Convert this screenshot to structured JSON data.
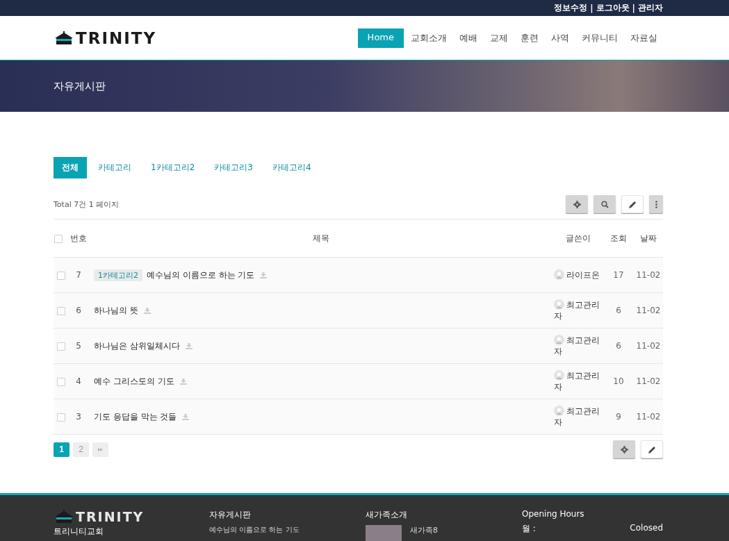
{
  "top_links": [
    "정보수정",
    "로그아웃",
    "관리자"
  ],
  "top_separator": "|",
  "logo": {
    "text": "TRINITY"
  },
  "nav": [
    {
      "label": "Home",
      "selected": true
    },
    {
      "label": "교회소개",
      "selected": false
    },
    {
      "label": "예배",
      "selected": false
    },
    {
      "label": "교제",
      "selected": false
    },
    {
      "label": "훈련",
      "selected": false
    },
    {
      "label": "사역",
      "selected": false
    },
    {
      "label": "커뮤니티",
      "selected": false
    },
    {
      "label": "자료실",
      "selected": false
    }
  ],
  "banner": {
    "title": "자유게시판"
  },
  "categories": [
    {
      "label": "전체",
      "selected": true
    },
    {
      "label": "카테고리",
      "selected": false
    },
    {
      "label": "1카테고리2",
      "selected": false
    },
    {
      "label": "카테고리3",
      "selected": false
    },
    {
      "label": "카테고리4",
      "selected": false
    }
  ],
  "summary": "Total 7건 1 페이지",
  "table": {
    "select_all_checked": false,
    "columns": [
      "번호",
      "제목",
      "글쓴이",
      "조회",
      "날짜"
    ],
    "rows": [
      {
        "checked": false,
        "number": "7",
        "category": "1카테고리2",
        "title": "예수님의 이름으로 하는 기도",
        "writer": "라이프온",
        "views": "17",
        "date": "11-02"
      },
      {
        "checked": false,
        "number": "6",
        "title": "하나님의 뜻",
        "writer": "최고관리자",
        "views": "6",
        "date": "11-02"
      },
      {
        "checked": false,
        "number": "5",
        "title": "하나님은 삼위일체시다",
        "writer": "최고관리자",
        "views": "6",
        "date": "11-02"
      },
      {
        "checked": false,
        "number": "4",
        "title": "예수 그리스도의 기도",
        "writer": "최고관리자",
        "views": "10",
        "date": "11-02"
      },
      {
        "checked": false,
        "number": "3",
        "title": "기도 응답을 막는 것들",
        "writer": "최고관리자",
        "views": "9",
        "date": "11-02"
      }
    ]
  },
  "pagination": [
    {
      "label": "1",
      "selected": true
    },
    {
      "label": "2",
      "selected": false
    }
  ],
  "footer": {
    "logo": "TRINITY",
    "org": "트리니티교회",
    "columns": [
      {
        "title": "자유게시판",
        "items": [
          "예수님의 이름으로 하는 기도"
        ]
      },
      {
        "title": "새가족소개",
        "items": [
          "새가족8"
        ]
      }
    ],
    "hours": {
      "title": "Opening Hours",
      "rows": [
        {
          "day": "월 :",
          "time": "Colosed"
        }
      ]
    }
  }
}
